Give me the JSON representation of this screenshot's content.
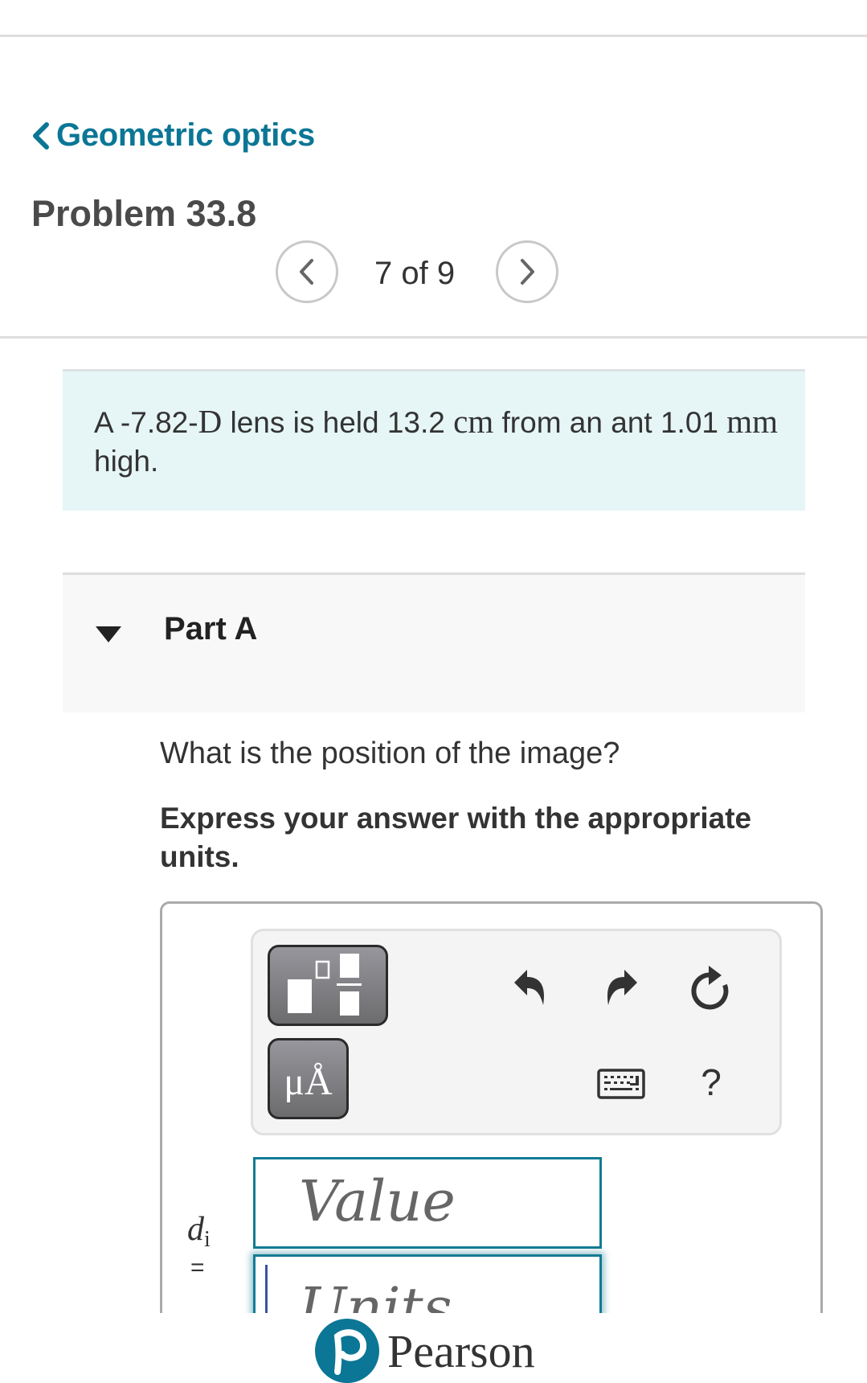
{
  "nav": {
    "back_label": "Geometric optics",
    "back_icon": "chevron-left-icon"
  },
  "header": {
    "title": "Problem 33.8",
    "pager": {
      "current": 7,
      "total": 9,
      "text": "7 of 9",
      "prev_icon": "chevron-left-icon",
      "next_icon": "chevron-right-icon"
    }
  },
  "intro": {
    "part1": "A -7.82-",
    "unit1": "D",
    "part2": " lens is held 13.2 ",
    "unit2": "cm",
    "part3": " from an ant 1.01 ",
    "unit3": "mm",
    "part4": " high."
  },
  "part": {
    "label": "Part A",
    "expanded": true,
    "question": "What is the position of the image?",
    "instruction": "Express your answer with the appropriate units."
  },
  "toolbar": {
    "template_button": "fraction-template-icon",
    "units_button_label": "μÅ",
    "undo_icon": "undo-icon",
    "redo_icon": "redo-icon",
    "reset_icon": "reset-icon",
    "keyboard_icon": "keyboard-icon",
    "help_label": "?"
  },
  "answer": {
    "variable": "d",
    "variable_sub": "i",
    "equals": "=",
    "value_placeholder": "Value",
    "units_placeholder": "Units"
  },
  "footer": {
    "brand": "Pearson",
    "colors": {
      "brand_teal": "#0b7695",
      "input_border": "#137b93"
    }
  }
}
